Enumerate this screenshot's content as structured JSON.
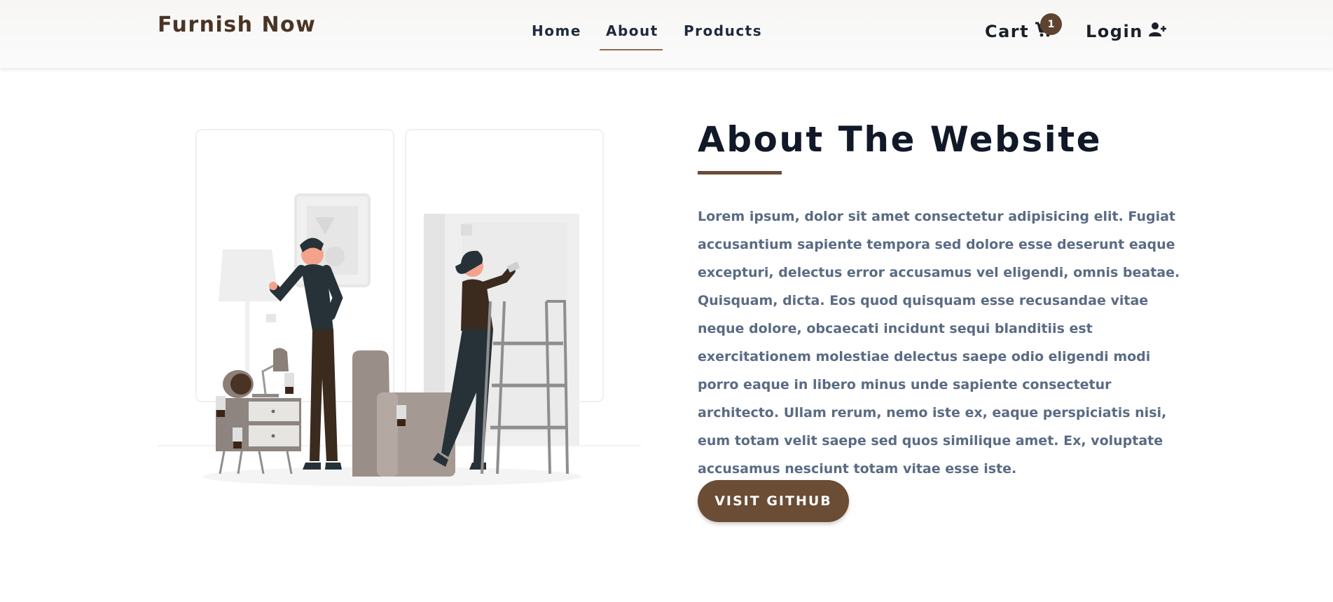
{
  "header": {
    "brand": "Furnish Now",
    "nav": [
      {
        "label": "Home"
      },
      {
        "label": "About"
      },
      {
        "label": "Products"
      }
    ],
    "cart_label": "Cart",
    "cart_count": "1",
    "login_label": "Login",
    "icons": {
      "cart": "shopping-cart-icon",
      "login": "user-plus-icon"
    }
  },
  "about": {
    "title": "About The Website",
    "body": "Lorem ipsum, dolor sit amet consectetur adipisicing elit. Fugiat accusantium sapiente tempora sed dolore esse deserunt eaque excepturi, delectus error accusamus vel eligendi, omnis beatae. Quisquam, dicta. Eos quod quisquam esse recusandae vitae neque dolore, obcaecati incidunt sequi blanditiis est exercitationem molestiae delectus saepe odio eligendi modi porro eaque in libero minus unde sapiente consectetur architecto. Ullam rerum, nemo iste ex, eaque perspiciatis nisi, eum totam velit saepe sed quos similique amet. Ex, voluptate accusamus nesciunt totam vitae esse iste.",
    "button_label": "VISIT GITHUB"
  },
  "colors": {
    "brand": "#4a3425",
    "accent": "#6b4c35",
    "heading": "#111827",
    "body_text": "#5a6b83"
  }
}
